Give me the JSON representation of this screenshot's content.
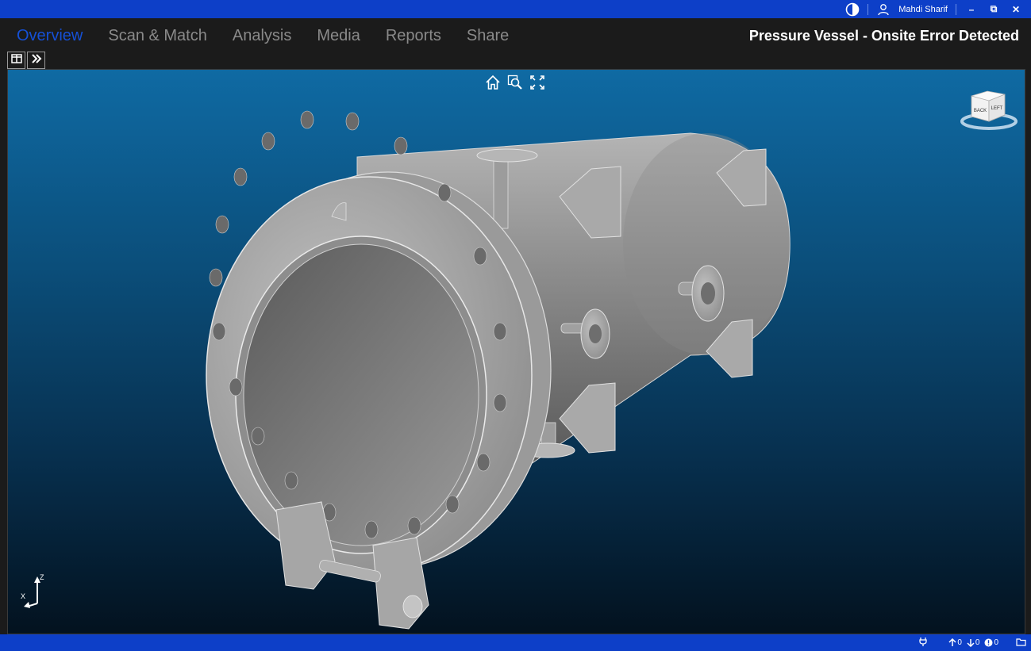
{
  "titlebar": {
    "user_name": "Mahdi Sharif",
    "theme_icon": "contrast-icon",
    "user_icon": "user-icon",
    "minimize_label": "–",
    "restore_label": "⧉",
    "close_label": "✕"
  },
  "nav": {
    "tabs": [
      {
        "label": "Overview",
        "active": true
      },
      {
        "label": "Scan & Match",
        "active": false
      },
      {
        "label": "Analysis",
        "active": false
      },
      {
        "label": "Media",
        "active": false
      },
      {
        "label": "Reports",
        "active": false
      },
      {
        "label": "Share",
        "active": false
      }
    ],
    "document_title": "Pressure Vessel - Onsite Error Detected"
  },
  "toolstrip": {
    "panel_icon": "panel-toggle-icon",
    "expand_icon": "double-chevron-right-icon"
  },
  "viewport": {
    "tools": [
      "home-icon",
      "zoom-fit-icon",
      "fullscreen-icon"
    ],
    "view_cube": {
      "face_back": "BACK",
      "face_left": "LEFT"
    },
    "axis": {
      "z": "Z",
      "x": "X"
    },
    "colors": {
      "bg_top": "#0f6aa3",
      "bg_bottom": "#03121f",
      "model": "#9a9a9a"
    }
  },
  "status": {
    "plug_icon": "plug-icon",
    "up_count": "0",
    "down_count": "0",
    "alert_count": "0",
    "folder_icon": "folder-icon"
  },
  "accent": "#0d3fc8"
}
